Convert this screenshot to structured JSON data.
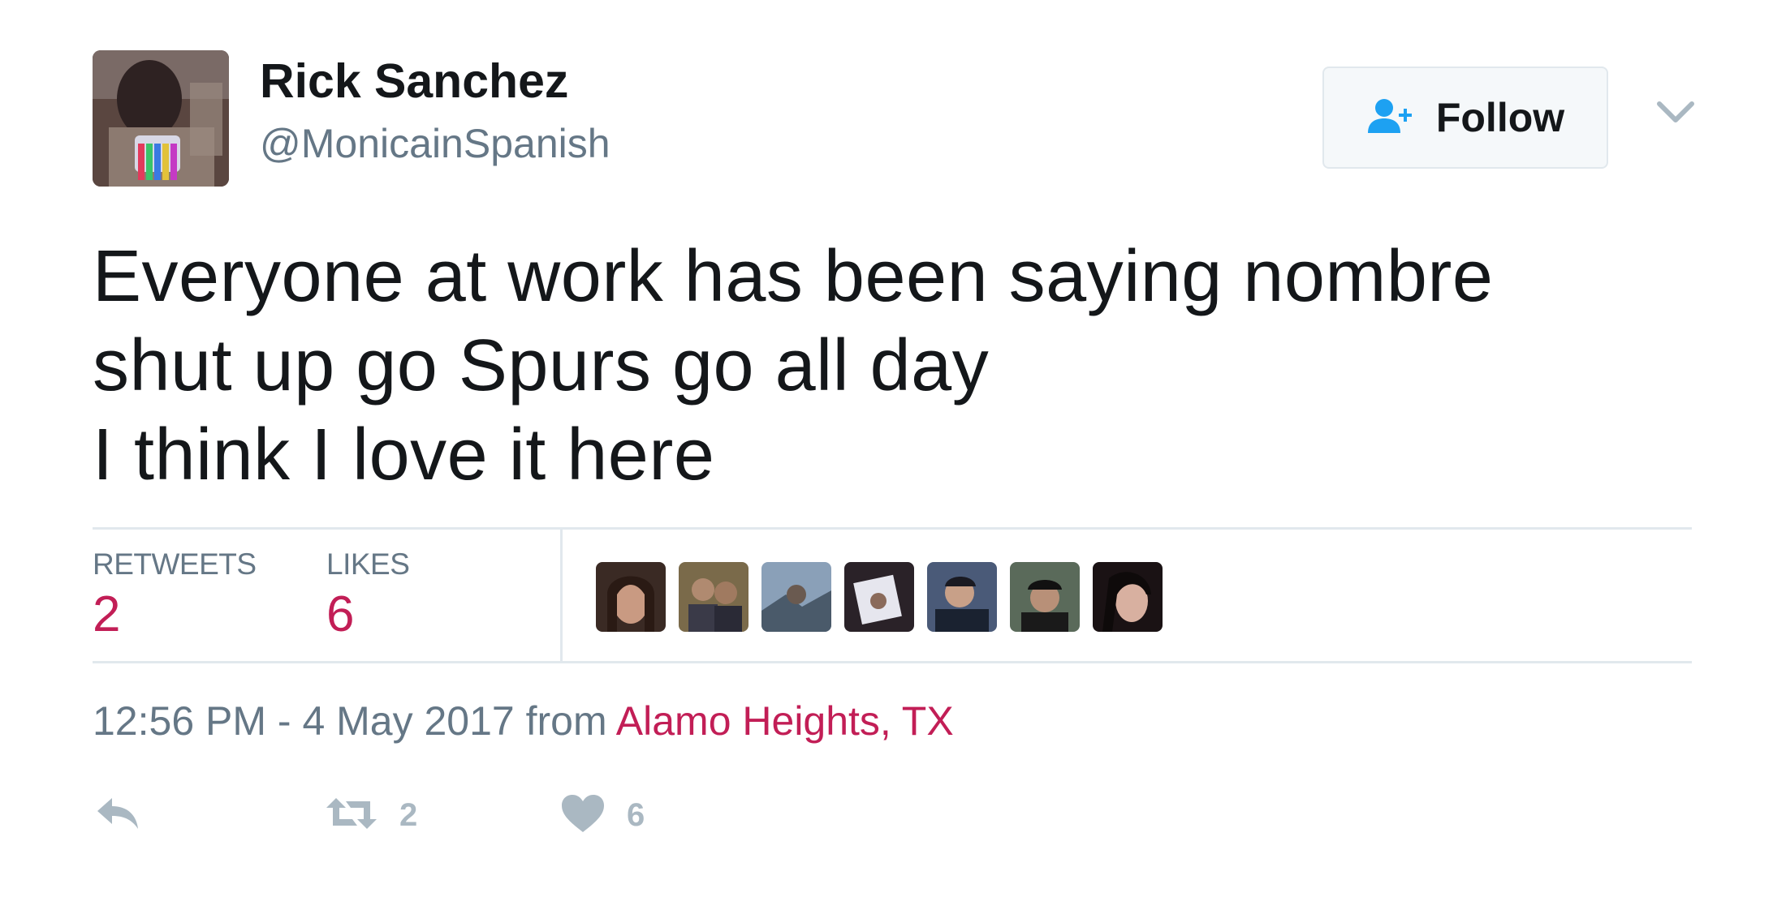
{
  "user": {
    "display_name": "Rick Sanchez",
    "handle": "@MonicainSpanish"
  },
  "follow_button": {
    "label": "Follow"
  },
  "tweet": {
    "lines": [
      "Everyone at work has been saying nombre",
      "shut up go Spurs go all day",
      "I think I love it here"
    ]
  },
  "stats": {
    "retweets_label": "RETWEETS",
    "retweets_count": "2",
    "likes_label": "LIKES",
    "likes_count": "6"
  },
  "meta": {
    "timestamp": "12:56 PM - 4 May 2017",
    "from_label": "from",
    "location": "Alamo Heights, TX"
  },
  "actions": {
    "retweet_count": "2",
    "like_count": "6"
  },
  "icons": {
    "follow": "add-person-icon",
    "dropdown": "chevron-down-icon",
    "reply": "reply-icon",
    "retweet": "retweet-icon",
    "like": "heart-icon"
  },
  "colors": {
    "accent": "#c21e56",
    "follow_icon": "#1da1f2",
    "muted_text": "#657786",
    "action_icon": "#aab8c2",
    "divider": "#e1e8ed"
  }
}
